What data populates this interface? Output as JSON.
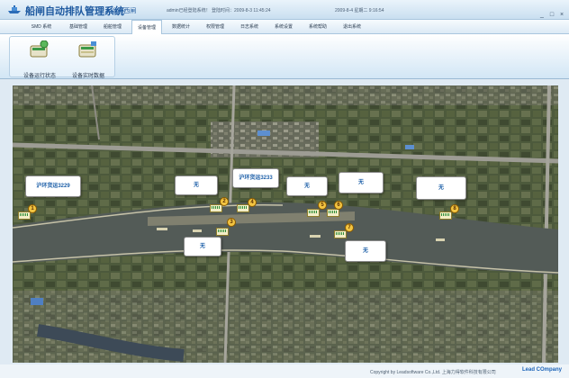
{
  "app": {
    "title": "船闸自动排队管理系统",
    "subtitle": "- 大治河西闸",
    "login_info": "admin已经登陆系统！ 登陆时间：2009-8-3 11:45:24",
    "date_info": "2009-8-4 星期二 9:16:54",
    "window_controls": [
      "_",
      "□",
      "×"
    ]
  },
  "menu": {
    "items": [
      "SMD 系统",
      "基础管理",
      "船舶管理",
      "设备管理",
      "数据统计",
      "权限管理",
      "日志系统",
      "系统设置",
      "系统帮助",
      "退出系统"
    ],
    "active_index": 3
  },
  "ribbon": {
    "buttons": [
      {
        "label": "设备运行状态",
        "icon": "device-status-icon"
      },
      {
        "label": "设备实时数据",
        "icon": "device-data-icon"
      }
    ]
  },
  "map": {
    "labels": [
      {
        "id": "1",
        "text": "沪环货运3229"
      },
      {
        "id": "2",
        "text": "无"
      },
      {
        "id": "3",
        "text": "无"
      },
      {
        "id": "4",
        "text": "沪环货运3233"
      },
      {
        "id": "5",
        "text": "无"
      },
      {
        "id": "6",
        "text": "无"
      },
      {
        "id": "7",
        "text": "无"
      },
      {
        "id": "8",
        "text": "无"
      }
    ],
    "colors": {
      "label_text": "#1d5fa8",
      "marker": "#f3c542"
    }
  },
  "footer": {
    "copyright": "Copyright by Leadsoftware Co.,Ltd.  上海力得软件科技有限公司",
    "logo_text": "Lead COmpany"
  }
}
